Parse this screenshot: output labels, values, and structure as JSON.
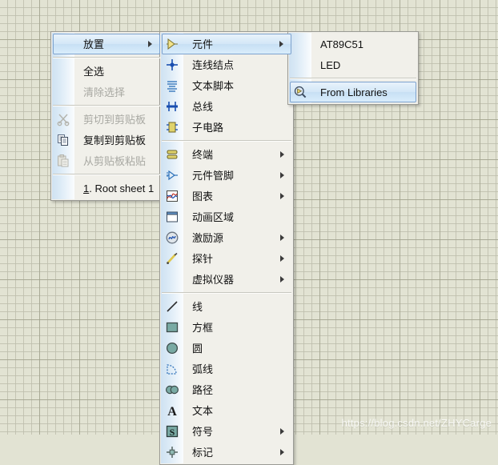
{
  "app": {
    "background": "schematic-grid",
    "grid_color": "#e2e3d3",
    "accent": "#c7e0f4",
    "watermark": "https://blog.csdn.net/ZHYCarge"
  },
  "menus": {
    "edit": {
      "name": "context-menu",
      "items": [
        {
          "label": "放置",
          "icon": "none",
          "submenu": true,
          "highlighted": true,
          "disabled": false
        },
        {
          "type": "separator"
        },
        {
          "label": "全选",
          "icon": "none",
          "submenu": false,
          "highlighted": false,
          "disabled": false
        },
        {
          "label": "清除选择",
          "icon": "none",
          "submenu": false,
          "highlighted": false,
          "disabled": true
        },
        {
          "type": "separator"
        },
        {
          "label": "剪切到剪贴板",
          "icon": "scissors-icon",
          "submenu": false,
          "highlighted": false,
          "disabled": true
        },
        {
          "label": "复制到剪贴板",
          "icon": "copy-icon",
          "submenu": false,
          "highlighted": false,
          "disabled": false
        },
        {
          "label": "从剪贴板粘贴",
          "icon": "paste-icon",
          "submenu": false,
          "highlighted": false,
          "disabled": true
        },
        {
          "type": "separator"
        },
        {
          "label": "1. Root sheet 1",
          "icon": "none",
          "submenu": false,
          "highlighted": false,
          "disabled": false,
          "accel_index": 1
        }
      ]
    },
    "place": {
      "name": "place-submenu",
      "items": [
        {
          "label": "元件",
          "icon": "component-icon",
          "submenu": true,
          "highlighted": true,
          "disabled": false
        },
        {
          "label": "连线结点",
          "icon": "junction-icon",
          "submenu": false,
          "highlighted": false,
          "disabled": false
        },
        {
          "label": "文本脚本",
          "icon": "script-icon",
          "submenu": false,
          "highlighted": false,
          "disabled": false
        },
        {
          "label": "总线",
          "icon": "bus-icon",
          "submenu": false,
          "highlighted": false,
          "disabled": false
        },
        {
          "label": "子电路",
          "icon": "subcircuit-icon",
          "submenu": false,
          "highlighted": false,
          "disabled": false
        },
        {
          "type": "separator"
        },
        {
          "label": "终端",
          "icon": "terminal-icon",
          "submenu": true,
          "highlighted": false,
          "disabled": false
        },
        {
          "label": "元件管脚",
          "icon": "pin-icon",
          "submenu": true,
          "highlighted": false,
          "disabled": false
        },
        {
          "label": "图表",
          "icon": "graph-icon",
          "submenu": true,
          "highlighted": false,
          "disabled": false
        },
        {
          "label": "动画区域",
          "icon": "tape-icon",
          "submenu": false,
          "highlighted": false,
          "disabled": false
        },
        {
          "label": "激励源",
          "icon": "generator-icon",
          "submenu": true,
          "highlighted": false,
          "disabled": false
        },
        {
          "label": "探针",
          "icon": "probe-icon",
          "submenu": true,
          "highlighted": false,
          "disabled": false
        },
        {
          "label": "虚拟仪器",
          "icon": "instrument-icon",
          "submenu": true,
          "highlighted": false,
          "disabled": false
        },
        {
          "type": "separator"
        },
        {
          "label": "线",
          "icon": "line-icon",
          "submenu": false,
          "highlighted": false,
          "disabled": false
        },
        {
          "label": "方框",
          "icon": "box-icon",
          "submenu": false,
          "highlighted": false,
          "disabled": false
        },
        {
          "label": "圆",
          "icon": "circle-icon",
          "submenu": false,
          "highlighted": false,
          "disabled": false
        },
        {
          "label": "弧线",
          "icon": "arc-icon",
          "submenu": false,
          "highlighted": false,
          "disabled": false
        },
        {
          "label": "路径",
          "icon": "path-icon",
          "submenu": false,
          "highlighted": false,
          "disabled": false
        },
        {
          "label": "文本",
          "icon": "text-icon",
          "submenu": false,
          "highlighted": false,
          "disabled": false
        },
        {
          "label": "符号",
          "icon": "symbol-icon",
          "submenu": true,
          "highlighted": false,
          "disabled": false
        },
        {
          "label": "标记",
          "icon": "marker-icon",
          "submenu": true,
          "highlighted": false,
          "disabled": false
        }
      ]
    },
    "component": {
      "name": "component-submenu",
      "items": [
        {
          "label": "AT89C51",
          "icon": "none",
          "submenu": false,
          "highlighted": false,
          "disabled": false
        },
        {
          "label": "LED",
          "icon": "none",
          "submenu": false,
          "highlighted": false,
          "disabled": false
        },
        {
          "type": "separator"
        },
        {
          "label": "From Libraries",
          "icon": "library-search-icon",
          "submenu": false,
          "highlighted": true,
          "disabled": false
        }
      ]
    }
  }
}
